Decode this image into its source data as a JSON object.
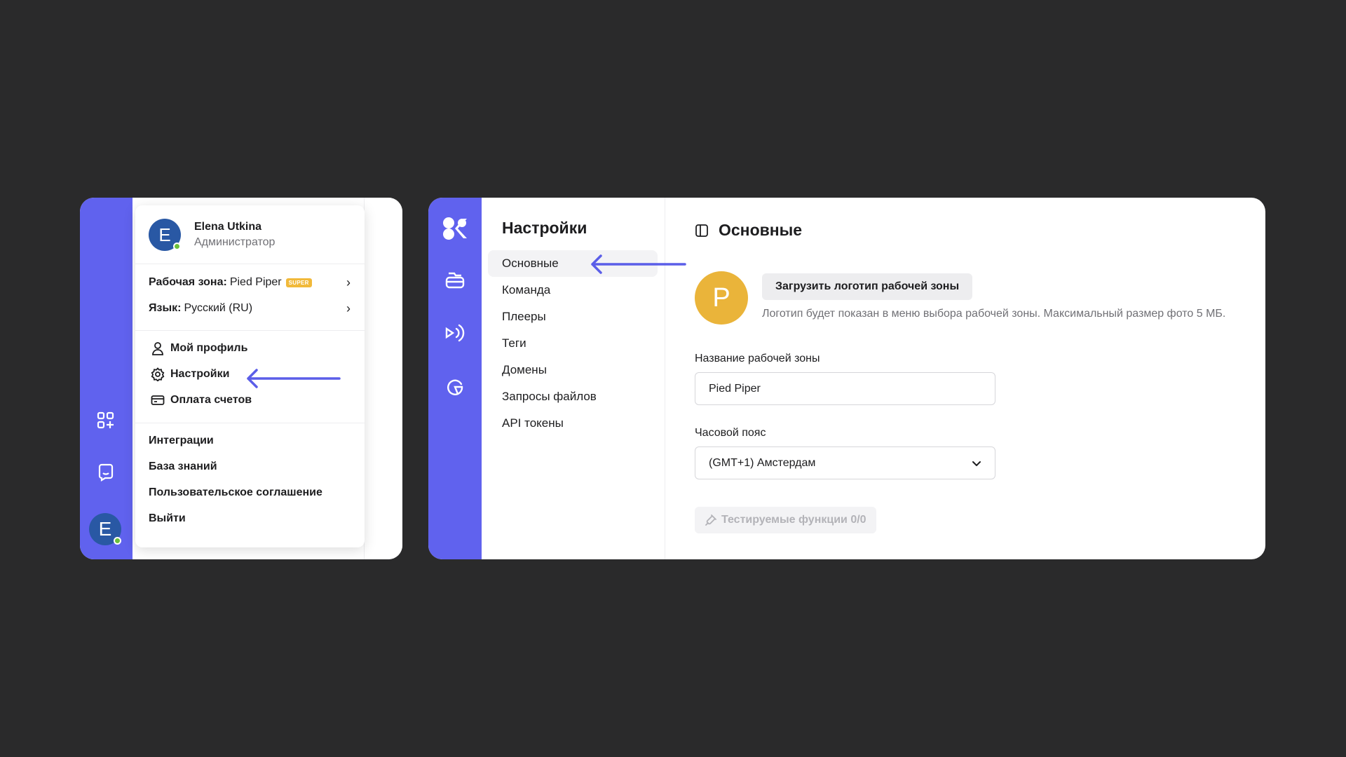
{
  "profile_menu": {
    "user": {
      "initial": "E",
      "name": "Elena Utkina",
      "role": "Администратор"
    },
    "workspace": {
      "label": "Рабочая зона:",
      "value": "Pied Piper",
      "badge": "SUPER"
    },
    "language": {
      "label": "Язык:",
      "value": "Русский (RU)"
    },
    "links": {
      "profile": "Мой профиль",
      "settings": "Настройки",
      "billing": "Оплата счетов"
    },
    "extra": {
      "integrations": "Интеграции",
      "knowledge_base": "База знаний",
      "user_agreement": "Пользовательское соглашение",
      "logout": "Выйти"
    },
    "rail_avatar_initial": "E"
  },
  "settings": {
    "nav_title": "Настройки",
    "nav_items": [
      "Основные",
      "Команда",
      "Плееры",
      "Теги",
      "Домены",
      "Запросы файлов",
      "API токены"
    ],
    "active_nav": "Основные",
    "page_title": "Основные",
    "logo_initial": "P",
    "upload_button": "Загрузить логотип рабочей зоны",
    "logo_hint": "Логотип будет показан в меню выбора рабочей зоны. Максимальный размер фото 5 МБ.",
    "workspace_name_label": "Название рабочей зоны",
    "workspace_name_value": "Pied Piper",
    "timezone_label": "Часовой пояс",
    "timezone_value": "(GMT+1) Амстердам",
    "beta_button": "Тестируемые функции 0/0"
  },
  "colors": {
    "background": "#2a2a2b",
    "rail": "#6062ee",
    "arrow": "#5b5ee8",
    "avatar": "#2958a4",
    "workspace_logo": "#eab43a",
    "badge": "#f1b93a",
    "online": "#6bbf3a"
  },
  "icons": {
    "rail_left": [
      "apps-add-icon",
      "chat-icon"
    ],
    "rail_right": [
      "brand-logo-icon",
      "folder-icon",
      "player-icon",
      "analytics-icon"
    ],
    "menu": [
      "user-icon",
      "gear-icon",
      "credit-card-icon"
    ]
  }
}
